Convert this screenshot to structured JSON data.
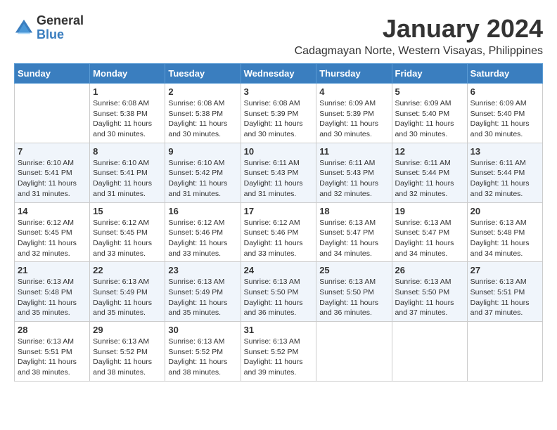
{
  "logo": {
    "general": "General",
    "blue": "Blue"
  },
  "title": "January 2024",
  "location": "Cadagmayan Norte, Western Visayas, Philippines",
  "days_header": [
    "Sunday",
    "Monday",
    "Tuesday",
    "Wednesday",
    "Thursday",
    "Friday",
    "Saturday"
  ],
  "weeks": [
    [
      {
        "day": "",
        "sunrise": "",
        "sunset": "",
        "daylight": ""
      },
      {
        "day": "1",
        "sunrise": "Sunrise: 6:08 AM",
        "sunset": "Sunset: 5:38 PM",
        "daylight": "Daylight: 11 hours and 30 minutes."
      },
      {
        "day": "2",
        "sunrise": "Sunrise: 6:08 AM",
        "sunset": "Sunset: 5:38 PM",
        "daylight": "Daylight: 11 hours and 30 minutes."
      },
      {
        "day": "3",
        "sunrise": "Sunrise: 6:08 AM",
        "sunset": "Sunset: 5:39 PM",
        "daylight": "Daylight: 11 hours and 30 minutes."
      },
      {
        "day": "4",
        "sunrise": "Sunrise: 6:09 AM",
        "sunset": "Sunset: 5:39 PM",
        "daylight": "Daylight: 11 hours and 30 minutes."
      },
      {
        "day": "5",
        "sunrise": "Sunrise: 6:09 AM",
        "sunset": "Sunset: 5:40 PM",
        "daylight": "Daylight: 11 hours and 30 minutes."
      },
      {
        "day": "6",
        "sunrise": "Sunrise: 6:09 AM",
        "sunset": "Sunset: 5:40 PM",
        "daylight": "Daylight: 11 hours and 30 minutes."
      }
    ],
    [
      {
        "day": "7",
        "sunrise": "Sunrise: 6:10 AM",
        "sunset": "Sunset: 5:41 PM",
        "daylight": "Daylight: 11 hours and 31 minutes."
      },
      {
        "day": "8",
        "sunrise": "Sunrise: 6:10 AM",
        "sunset": "Sunset: 5:41 PM",
        "daylight": "Daylight: 11 hours and 31 minutes."
      },
      {
        "day": "9",
        "sunrise": "Sunrise: 6:10 AM",
        "sunset": "Sunset: 5:42 PM",
        "daylight": "Daylight: 11 hours and 31 minutes."
      },
      {
        "day": "10",
        "sunrise": "Sunrise: 6:11 AM",
        "sunset": "Sunset: 5:43 PM",
        "daylight": "Daylight: 11 hours and 31 minutes."
      },
      {
        "day": "11",
        "sunrise": "Sunrise: 6:11 AM",
        "sunset": "Sunset: 5:43 PM",
        "daylight": "Daylight: 11 hours and 32 minutes."
      },
      {
        "day": "12",
        "sunrise": "Sunrise: 6:11 AM",
        "sunset": "Sunset: 5:44 PM",
        "daylight": "Daylight: 11 hours and 32 minutes."
      },
      {
        "day": "13",
        "sunrise": "Sunrise: 6:11 AM",
        "sunset": "Sunset: 5:44 PM",
        "daylight": "Daylight: 11 hours and 32 minutes."
      }
    ],
    [
      {
        "day": "14",
        "sunrise": "Sunrise: 6:12 AM",
        "sunset": "Sunset: 5:45 PM",
        "daylight": "Daylight: 11 hours and 32 minutes."
      },
      {
        "day": "15",
        "sunrise": "Sunrise: 6:12 AM",
        "sunset": "Sunset: 5:45 PM",
        "daylight": "Daylight: 11 hours and 33 minutes."
      },
      {
        "day": "16",
        "sunrise": "Sunrise: 6:12 AM",
        "sunset": "Sunset: 5:46 PM",
        "daylight": "Daylight: 11 hours and 33 minutes."
      },
      {
        "day": "17",
        "sunrise": "Sunrise: 6:12 AM",
        "sunset": "Sunset: 5:46 PM",
        "daylight": "Daylight: 11 hours and 33 minutes."
      },
      {
        "day": "18",
        "sunrise": "Sunrise: 6:13 AM",
        "sunset": "Sunset: 5:47 PM",
        "daylight": "Daylight: 11 hours and 34 minutes."
      },
      {
        "day": "19",
        "sunrise": "Sunrise: 6:13 AM",
        "sunset": "Sunset: 5:47 PM",
        "daylight": "Daylight: 11 hours and 34 minutes."
      },
      {
        "day": "20",
        "sunrise": "Sunrise: 6:13 AM",
        "sunset": "Sunset: 5:48 PM",
        "daylight": "Daylight: 11 hours and 34 minutes."
      }
    ],
    [
      {
        "day": "21",
        "sunrise": "Sunrise: 6:13 AM",
        "sunset": "Sunset: 5:48 PM",
        "daylight": "Daylight: 11 hours and 35 minutes."
      },
      {
        "day": "22",
        "sunrise": "Sunrise: 6:13 AM",
        "sunset": "Sunset: 5:49 PM",
        "daylight": "Daylight: 11 hours and 35 minutes."
      },
      {
        "day": "23",
        "sunrise": "Sunrise: 6:13 AM",
        "sunset": "Sunset: 5:49 PM",
        "daylight": "Daylight: 11 hours and 35 minutes."
      },
      {
        "day": "24",
        "sunrise": "Sunrise: 6:13 AM",
        "sunset": "Sunset: 5:50 PM",
        "daylight": "Daylight: 11 hours and 36 minutes."
      },
      {
        "day": "25",
        "sunrise": "Sunrise: 6:13 AM",
        "sunset": "Sunset: 5:50 PM",
        "daylight": "Daylight: 11 hours and 36 minutes."
      },
      {
        "day": "26",
        "sunrise": "Sunrise: 6:13 AM",
        "sunset": "Sunset: 5:50 PM",
        "daylight": "Daylight: 11 hours and 37 minutes."
      },
      {
        "day": "27",
        "sunrise": "Sunrise: 6:13 AM",
        "sunset": "Sunset: 5:51 PM",
        "daylight": "Daylight: 11 hours and 37 minutes."
      }
    ],
    [
      {
        "day": "28",
        "sunrise": "Sunrise: 6:13 AM",
        "sunset": "Sunset: 5:51 PM",
        "daylight": "Daylight: 11 hours and 38 minutes."
      },
      {
        "day": "29",
        "sunrise": "Sunrise: 6:13 AM",
        "sunset": "Sunset: 5:52 PM",
        "daylight": "Daylight: 11 hours and 38 minutes."
      },
      {
        "day": "30",
        "sunrise": "Sunrise: 6:13 AM",
        "sunset": "Sunset: 5:52 PM",
        "daylight": "Daylight: 11 hours and 38 minutes."
      },
      {
        "day": "31",
        "sunrise": "Sunrise: 6:13 AM",
        "sunset": "Sunset: 5:52 PM",
        "daylight": "Daylight: 11 hours and 39 minutes."
      },
      {
        "day": "",
        "sunrise": "",
        "sunset": "",
        "daylight": ""
      },
      {
        "day": "",
        "sunrise": "",
        "sunset": "",
        "daylight": ""
      },
      {
        "day": "",
        "sunrise": "",
        "sunset": "",
        "daylight": ""
      }
    ]
  ]
}
